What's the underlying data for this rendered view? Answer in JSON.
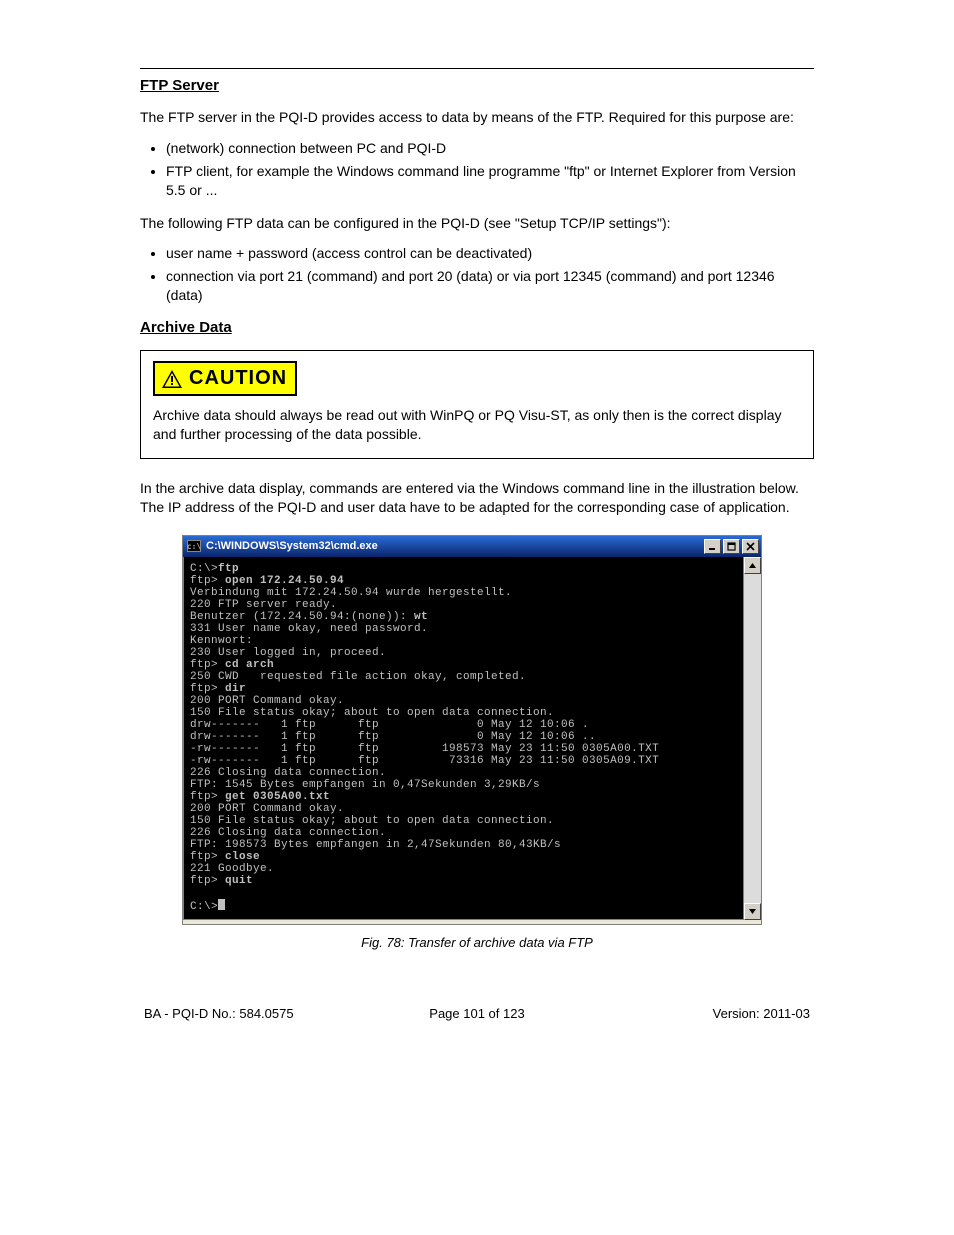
{
  "header": {
    "rule": true
  },
  "section1": {
    "title": "FTP Server",
    "para1": "The FTP server in the PQI-D provides access to data by means of the FTP. Required for this purpose are:",
    "reqs": [
      "(network) connection between PC and PQI-D",
      "FTP client, for example the Windows command line programme \"ftp\" or Internet Explorer from Version 5.5 or ..."
    ],
    "para2": "The following FTP data can be configured in the PQI-D (see \"Setup TCP/IP settings\"):",
    "cfg": [
      "user name + password (access control can be deactivated)",
      "connection via port 21 (command) and port 20 (data) or via port 12345 (command) and port 12346 (data)"
    ]
  },
  "section2": {
    "title": "Archive Data",
    "caution_label": "CAUTION",
    "caution_text": "Archive data should always be read out with WinPQ or PQ Visu-ST, as only then is the correct display and further processing of the data possible.",
    "para3": "In the archive data display, commands are entered via the Windows command line in the illustration below. The IP address of the PQI-D and user data have to be adapted for the corresponding case of application.",
    "terminal_title": "C:\\WINDOWS\\System32\\cmd.exe",
    "terminal_lines": [
      "C:\\>ftp",
      "ftp> open 172.24.50.94",
      "Verbindung mit 172.24.50.94 wurde hergestellt.",
      "220 FTP server ready.",
      "Benutzer (172.24.50.94:(none)): wt",
      "331 User name okay, need password.",
      "Kennwort:",
      "230 User logged in, proceed.",
      "ftp> cd arch",
      "250 CWD   requested file action okay, completed.",
      "ftp> dir",
      "200 PORT Command okay.",
      "150 File status okay; about to open data connection.",
      "drw-------   1 ftp      ftp              0 May 12 10:06 .",
      "drw-------   1 ftp      ftp              0 May 12 10:06 ..",
      "-rw-------   1 ftp      ftp         198573 May 23 11:50 0305A00.TXT",
      "-rw-------   1 ftp      ftp          73316 May 23 11:50 0305A09.TXT",
      "226 Closing data connection.",
      "FTP: 1545 Bytes empfangen in 0,47Sekunden 3,29KB/s",
      "ftp> get 0305A00.txt",
      "200 PORT Command okay.",
      "150 File status okay; about to open data connection.",
      "226 Closing data connection.",
      "FTP: 198573 Bytes empfangen in 2,47Sekunden 80,43KB/s",
      "ftp> close",
      "221 Goodbye.",
      "ftp> quit",
      "",
      "C:\\>"
    ],
    "caption": "Fig. 78: Transfer of archive data via FTP"
  },
  "footer": {
    "left": "BA - PQI-D No.: 584.0575",
    "center": "Page 101 of 123",
    "right": "Version: 2011-03"
  }
}
